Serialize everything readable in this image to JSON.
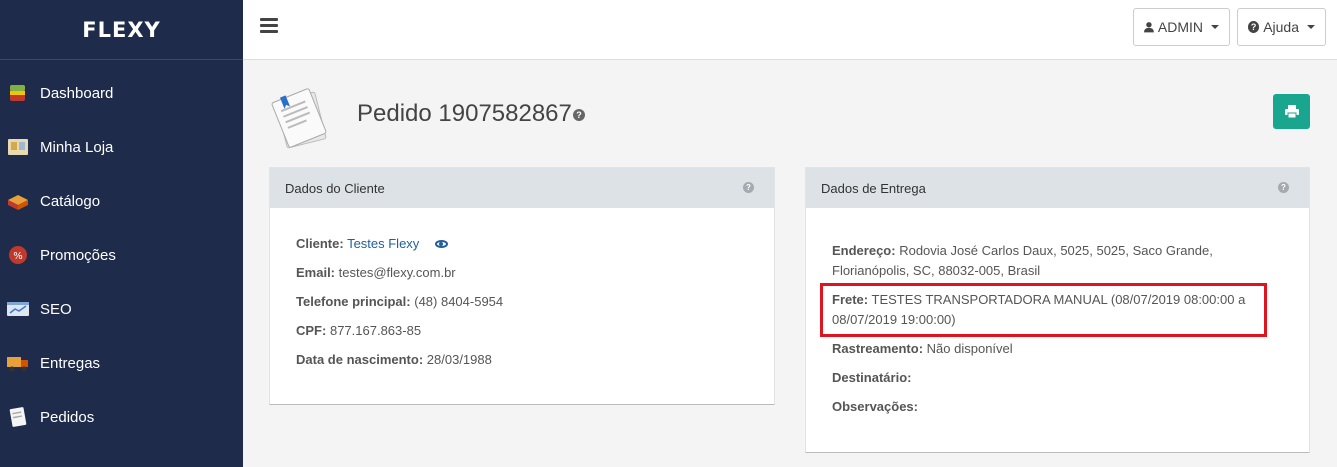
{
  "brand": {
    "name": "FLEXY"
  },
  "sidebar": {
    "items": [
      {
        "label": "Dashboard",
        "icon": "dashboard-icon"
      },
      {
        "label": "Minha Loja",
        "icon": "store-icon"
      },
      {
        "label": "Catálogo",
        "icon": "catalog-icon"
      },
      {
        "label": "Promoções",
        "icon": "promotion-icon"
      },
      {
        "label": "SEO",
        "icon": "seo-icon"
      },
      {
        "label": "Entregas",
        "icon": "truck-icon"
      },
      {
        "label": "Pedidos",
        "icon": "orders-icon"
      }
    ]
  },
  "topbar": {
    "user_label": "ADMIN",
    "help_label": "Ajuda"
  },
  "page": {
    "title": "Pedido 1907582867"
  },
  "cliente": {
    "heading": "Dados do Cliente",
    "cliente_label": "Cliente:",
    "cliente_value": "Testes Flexy",
    "email_label": "Email:",
    "email_value": "testes@flexy.com.br",
    "telefone_label": "Telefone principal:",
    "telefone_value": "(48) 8404-5954",
    "cpf_label": "CPF:",
    "cpf_value": "877.167.863-85",
    "nascimento_label": "Data de nascimento:",
    "nascimento_value": "28/03/1988"
  },
  "entrega": {
    "heading": "Dados de Entrega",
    "endereco_label": "Endereço:",
    "endereco_value": "Rodovia José Carlos Daux, 5025, 5025, Saco Grande, Florianópolis, SC, 88032-005, Brasil",
    "frete_label": "Frete:",
    "frete_value": "TESTES TRANSPORTADORA MANUAL (08/07/2019 08:00:00 a 08/07/2019 19:00:00)",
    "rastreamento_label": "Rastreamento:",
    "rastreamento_value": "Não disponível",
    "destinatario_label": "Destinatário:",
    "observacoes_label": "Observações:"
  },
  "colors": {
    "sidebar_bg": "#1e2b4a",
    "accent": "#1aa68e",
    "highlight": "#e0141f",
    "link": "#1f5f9c"
  }
}
